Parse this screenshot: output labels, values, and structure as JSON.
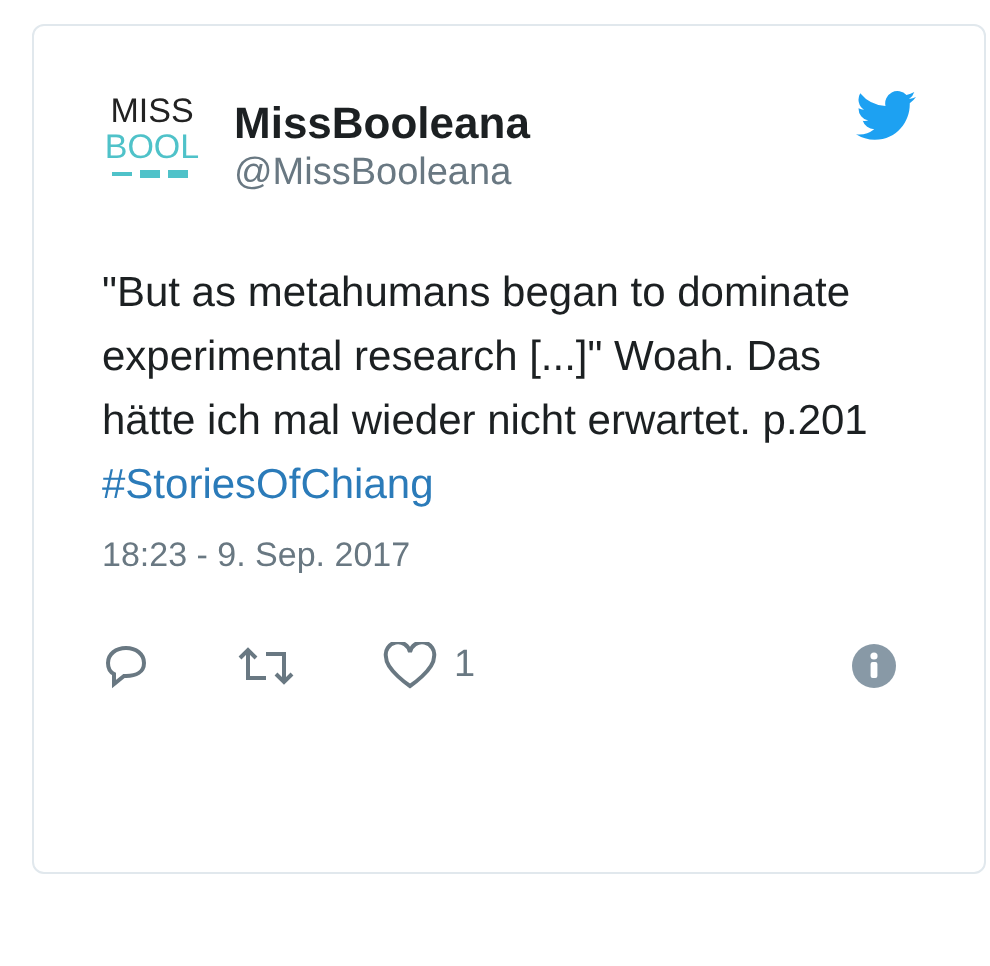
{
  "author": {
    "avatar_lines": [
      "MISS",
      "BOOL"
    ],
    "name": "MissBooleana",
    "handle": "@MissBooleana"
  },
  "text_lines": [
    {
      "kind": "plain",
      "text": "\"But as metahumans began to dominate experimental research [...]\" Woah. Das hätte ich mal wieder nicht erwartet. p.201"
    },
    {
      "kind": "hashtag",
      "text": "#StoriesOfChiang"
    }
  ],
  "timestamp": "18:23 - 9. Sep. 2017",
  "actions": {
    "likes": "1"
  }
}
